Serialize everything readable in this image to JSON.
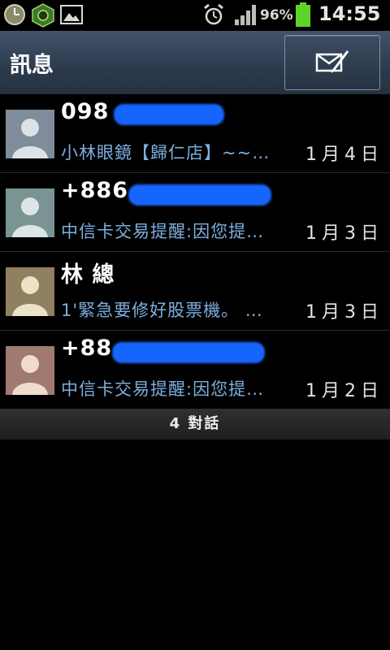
{
  "status_bar": {
    "battery_percent": "96%",
    "time": "14:55",
    "icons": [
      "clock-icon",
      "game-app-icon",
      "gallery-icon",
      "alarm-icon",
      "signal-icon",
      "battery-icon"
    ]
  },
  "header": {
    "title": "訊息",
    "compose_icon": "compose-message-icon"
  },
  "conversations": [
    {
      "sender": "098",
      "preview": "小林眼鏡【歸仁店】~~…",
      "date": "1月4日",
      "avatar_color": "#7f8c99"
    },
    {
      "sender": "+886",
      "preview": "中信卡交易提醒:因您提…",
      "date": "1月3日",
      "avatar_color": "#7a9494"
    },
    {
      "sender": "林 總",
      "preview": "1'緊急要修好股票機。 …",
      "date": "1月3日",
      "avatar_color": "#8f8060"
    },
    {
      "sender": "+88",
      "preview": "中信卡交易提醒:因您提…",
      "date": "1月2日",
      "avatar_color": "#a07a70"
    }
  ],
  "footer": {
    "count_label": "4 對話"
  },
  "colors": {
    "preview_text": "#7dafdf",
    "redaction": "#1565ff",
    "title_bar": "#2c3a4d"
  }
}
